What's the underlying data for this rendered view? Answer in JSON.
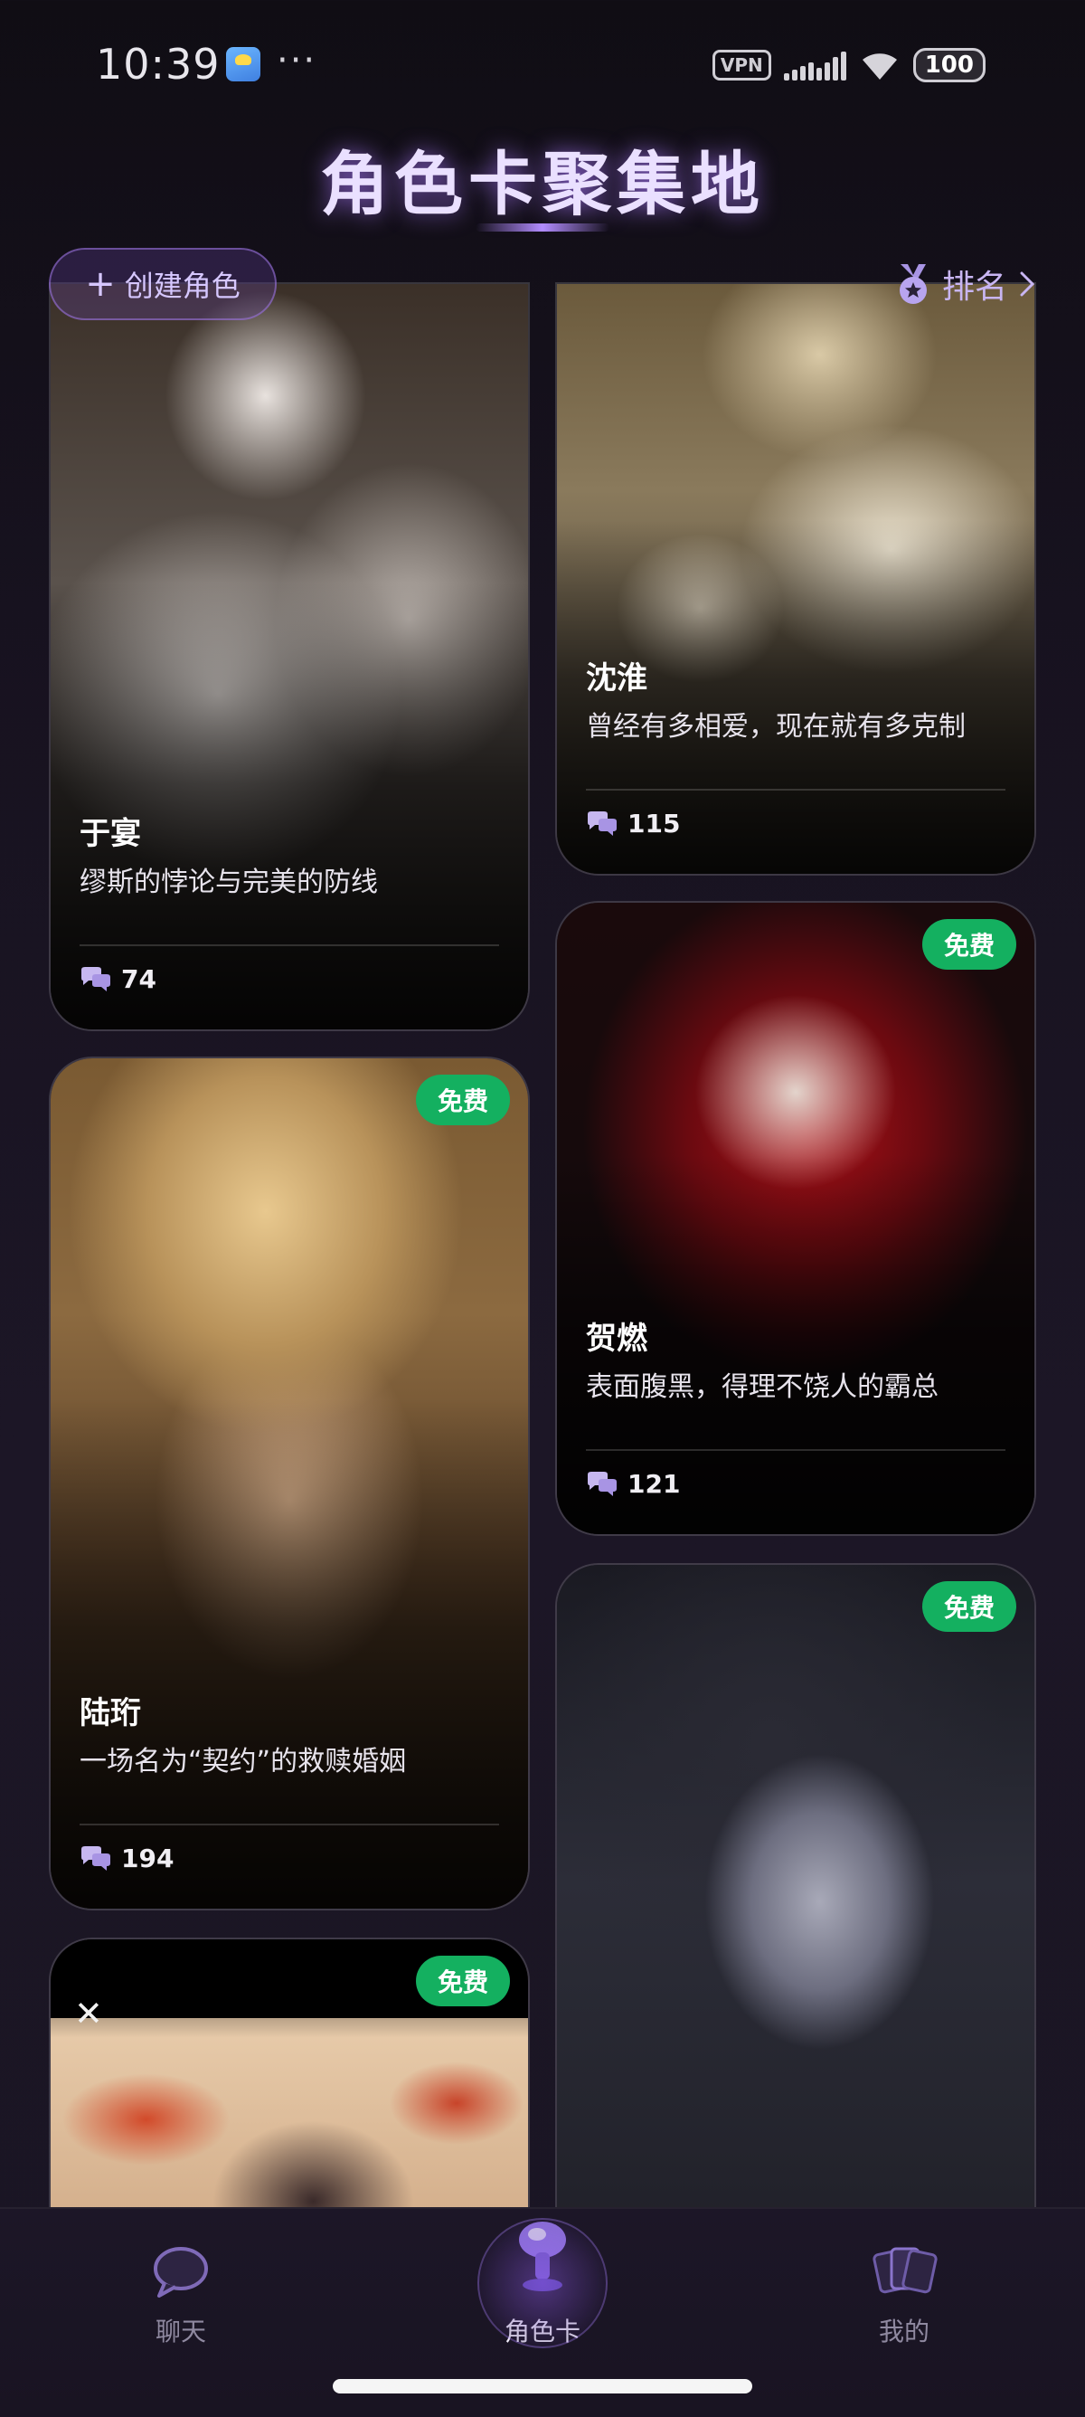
{
  "status_bar": {
    "time": "10:39",
    "dots": "···",
    "vpn": "VPN",
    "battery": "100"
  },
  "page": {
    "title": "角色卡聚集地",
    "create_label": "创建角色",
    "ranking_label": "排名"
  },
  "colors": {
    "accent": "#b28cff",
    "free_badge": "#14b060",
    "background": "#17121f"
  },
  "cards": [
    {
      "name": "于宴",
      "desc": "缪斯的悖论与完美的防线",
      "count": "74",
      "free": false
    },
    {
      "name": "沈淮",
      "desc": "曾经有多相爱，现在就有多克制",
      "count": "115",
      "free": false
    },
    {
      "name": "贺燃",
      "desc": "表面腹黑，得理不饶人的霸总",
      "count": "121",
      "free": true,
      "badge": "免费"
    },
    {
      "name": "陆珩",
      "desc": "一场名为“契约”的救赎婚姻",
      "count": "194",
      "free": true,
      "badge": "免费"
    },
    {
      "name": "",
      "desc": "",
      "count": "",
      "free": true,
      "badge": "免费"
    },
    {
      "name": "",
      "desc": "",
      "count": "",
      "free": true,
      "badge": "免费"
    }
  ],
  "tabs": [
    {
      "label": "聊天",
      "icon": "chat-bubble-icon",
      "active": false
    },
    {
      "label": "角色卡",
      "icon": "mushroom-cloud-icon",
      "active": true
    },
    {
      "label": "我的",
      "icon": "cards-stack-icon",
      "active": false
    }
  ]
}
